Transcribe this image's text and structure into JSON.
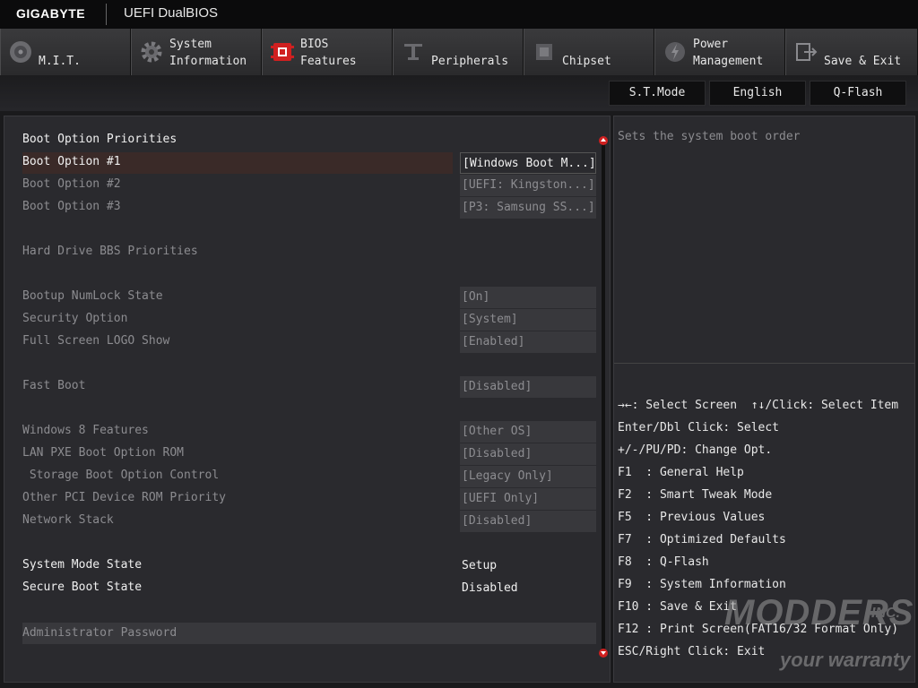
{
  "header": {
    "brand": "GIGABYTE",
    "title": "UEFI DualBIOS"
  },
  "tabs": [
    {
      "id": "mit",
      "label": "M.I.T.",
      "icon": "speedometer-icon"
    },
    {
      "id": "system",
      "label": "System\nInformation",
      "icon": "gear-icon"
    },
    {
      "id": "bios",
      "label": "BIOS\nFeatures",
      "icon": "bios-chip-icon",
      "active": true
    },
    {
      "id": "peripherals",
      "label": "Peripherals",
      "icon": "peripherals-icon"
    },
    {
      "id": "chipset",
      "label": "Chipset",
      "icon": "chip-icon"
    },
    {
      "id": "power",
      "label": "Power\nManagement",
      "icon": "power-icon"
    },
    {
      "id": "save",
      "label": "Save & Exit",
      "icon": "exit-icon"
    }
  ],
  "subbar": {
    "stmode": "S.T.Mode",
    "language": "English",
    "qflash": "Q-Flash"
  },
  "settings": {
    "boot_priorities_heading": "Boot Option Priorities",
    "boot1": {
      "label": "Boot Option #1",
      "value": "[Windows Boot M...]"
    },
    "boot2": {
      "label": "Boot Option #2",
      "value": "[UEFI: Kingston...]"
    },
    "boot3": {
      "label": "Boot Option #3",
      "value": "[P3: Samsung SS...]"
    },
    "hdd_bbs": "Hard Drive BBS Priorities",
    "numlock": {
      "label": "Bootup NumLock State",
      "value": "[On]"
    },
    "security": {
      "label": "Security Option",
      "value": "[System]"
    },
    "logo": {
      "label": "Full Screen LOGO Show",
      "value": "[Enabled]"
    },
    "fastboot": {
      "label": "Fast Boot",
      "value": "[Disabled]"
    },
    "win8": {
      "label": "Windows 8 Features",
      "value": "[Other OS]"
    },
    "lanpxe": {
      "label": "LAN PXE Boot Option ROM",
      "value": "[Disabled]"
    },
    "storage": {
      "label": " Storage Boot Option Control",
      "value": "[Legacy Only]"
    },
    "otherpci": {
      "label": "Other PCI Device ROM Priority",
      "value": "[UEFI Only]"
    },
    "netstack": {
      "label": "Network Stack",
      "value": "[Disabled]"
    },
    "sysmode": {
      "label": "System Mode State",
      "value": "Setup"
    },
    "secureboot": {
      "label": "Secure Boot State",
      "value": "Disabled"
    },
    "admin_pwd": "Administrator Password"
  },
  "help": {
    "description": "Sets the system boot order",
    "keys": [
      "→←: Select Screen  ↑↓/Click: Select Item",
      "Enter/Dbl Click: Select",
      "+/-/PU/PD: Change Opt.",
      "F1  : General Help",
      "F2  : Smart Tweak Mode",
      "F5  : Previous Values",
      "F7  : Optimized Defaults",
      "F8  : Q-Flash",
      "F9  : System Information",
      "F10 : Save & Exit",
      "F12 : Print Screen(FAT16/32 Format Only)",
      "ESC/Right Click: Exit"
    ]
  },
  "watermark": {
    "line1": "MODDERS",
    "line2": "INC.",
    "line3": "your warranty"
  },
  "colors": {
    "accent": "#d02020",
    "panel": "#2a2a2e",
    "value_box": "#38383c"
  }
}
